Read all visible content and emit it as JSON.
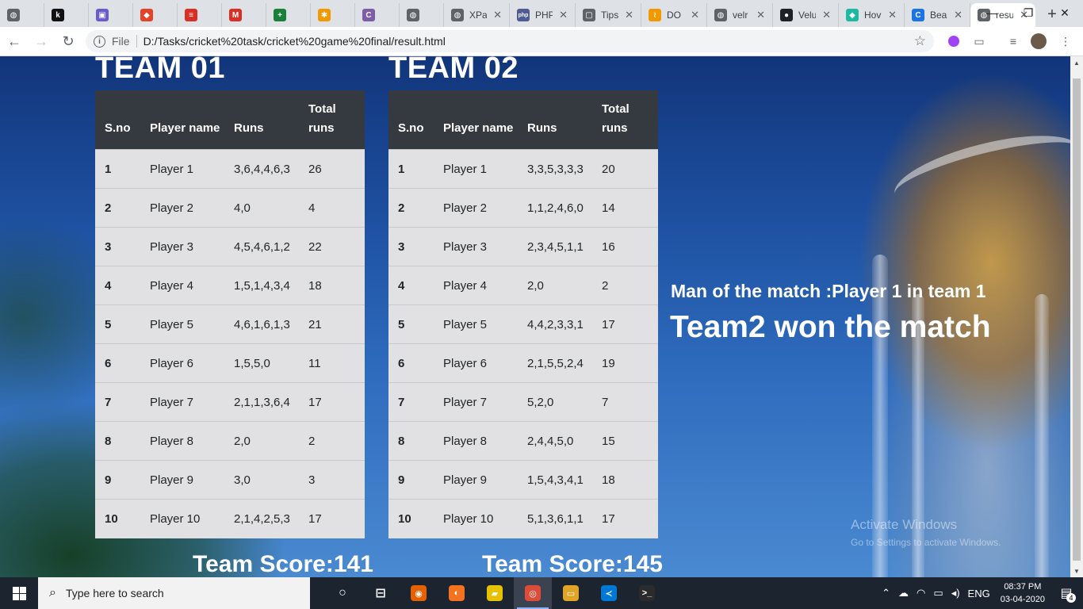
{
  "browser": {
    "tabs": [
      {
        "title": "",
        "icon": "globe-icon",
        "color": "#5f6368",
        "glyph": "◍"
      },
      {
        "title": "",
        "icon": "k-logo-icon",
        "color": "#111111",
        "glyph": "k"
      },
      {
        "title": "",
        "icon": "chat-icon",
        "color": "#6a5acd",
        "glyph": "▣"
      },
      {
        "title": "",
        "icon": "gitlab-icon",
        "color": "#e24329",
        "glyph": "◆"
      },
      {
        "title": "",
        "icon": "notes-icon",
        "color": "#d93025",
        "glyph": "≡"
      },
      {
        "title": "",
        "icon": "gmail-icon",
        "color": "#d93025",
        "glyph": "M"
      },
      {
        "title": "",
        "icon": "plus-doc-icon",
        "color": "#188038",
        "glyph": "+"
      },
      {
        "title": "",
        "icon": "sparkle-icon",
        "color": "#f29900",
        "glyph": "✱"
      },
      {
        "title": "",
        "icon": "c-logo-icon",
        "color": "#7b5ea7",
        "glyph": "C"
      },
      {
        "title": "",
        "icon": "globe-icon",
        "color": "#5f6368",
        "glyph": "◍"
      },
      {
        "title": "XPa",
        "icon": "globe-icon",
        "color": "#5f6368",
        "glyph": "◍"
      },
      {
        "title": "PHP",
        "icon": "php-icon",
        "color": "#4f5b93",
        "glyph": "php"
      },
      {
        "title": "Tips",
        "icon": "shield-icon",
        "color": "#5f6368",
        "glyph": "▢"
      },
      {
        "title": "DO",
        "icon": "brush-icon",
        "color": "#f29900",
        "glyph": "≀"
      },
      {
        "title": "velr",
        "icon": "globe-icon",
        "color": "#5f6368",
        "glyph": "◍"
      },
      {
        "title": "Velu",
        "icon": "github-icon",
        "color": "#202124",
        "glyph": "●"
      },
      {
        "title": "Hov",
        "icon": "gem-icon",
        "color": "#1db9a0",
        "glyph": "◆"
      },
      {
        "title": "Bea",
        "icon": "c-logo-icon",
        "color": "#1a73e8",
        "glyph": "C"
      }
    ],
    "active_tab": {
      "title": "resu",
      "icon": "globe-icon"
    },
    "new_tab": "+",
    "window": {
      "minimize": "—",
      "maximize": "❐",
      "close": "✕"
    },
    "address": {
      "file_label": "File",
      "url": "D:/Tasks/cricket%20task/cricket%20game%20final/result.html"
    }
  },
  "page": {
    "teams": [
      {
        "title": "TEAM 01",
        "headers": [
          "S.no",
          "Player name",
          "Runs",
          "Total runs"
        ],
        "rows": [
          [
            "1",
            "Player 1",
            "3,6,4,4,6,3",
            "26"
          ],
          [
            "2",
            "Player 2",
            "4,0",
            "4"
          ],
          [
            "3",
            "Player 3",
            "4,5,4,6,1,2",
            "22"
          ],
          [
            "4",
            "Player 4",
            "1,5,1,4,3,4",
            "18"
          ],
          [
            "5",
            "Player 5",
            "4,6,1,6,1,3",
            "21"
          ],
          [
            "6",
            "Player 6",
            "1,5,5,0",
            "11"
          ],
          [
            "7",
            "Player 7",
            "2,1,1,3,6,4",
            "17"
          ],
          [
            "8",
            "Player 8",
            "2,0",
            "2"
          ],
          [
            "9",
            "Player 9",
            "3,0",
            "3"
          ],
          [
            "10",
            "Player 10",
            "2,1,4,2,5,3",
            "17"
          ]
        ],
        "team_score": "Team Score:141"
      },
      {
        "title": "TEAM 02",
        "headers": [
          "S.no",
          "Player name",
          "Runs",
          "Total runs"
        ],
        "rows": [
          [
            "1",
            "Player 1",
            "3,3,5,3,3,3",
            "20"
          ],
          [
            "2",
            "Player 2",
            "1,1,2,4,6,0",
            "14"
          ],
          [
            "3",
            "Player 3",
            "2,3,4,5,1,1",
            "16"
          ],
          [
            "4",
            "Player 4",
            "2,0",
            "2"
          ],
          [
            "5",
            "Player 5",
            "4,4,2,3,3,1",
            "17"
          ],
          [
            "6",
            "Player 6",
            "2,1,5,5,2,4",
            "19"
          ],
          [
            "7",
            "Player 7",
            "5,2,0",
            "7"
          ],
          [
            "8",
            "Player 8",
            "2,4,4,5,0",
            "15"
          ],
          [
            "9",
            "Player 9",
            "1,5,4,3,4,1",
            "18"
          ],
          [
            "10",
            "Player 10",
            "5,1,3,6,1,1",
            "17"
          ]
        ],
        "team_score": "Team Score:145"
      }
    ],
    "man_of_the_match": "Man of the match :Player 1 in team 1",
    "result": "Team2 won the match",
    "watermark": {
      "line1": "Activate Windows",
      "line2": "Go to Settings to activate Windows."
    }
  },
  "taskbar": {
    "search_placeholder": "Type here to search",
    "apps": [
      {
        "name": "task-view-icon",
        "glyph": "○",
        "color": "#1c2430"
      },
      {
        "name": "timeline-icon",
        "glyph": "⊟",
        "color": "#1c2430"
      },
      {
        "name": "firefox-icon",
        "glyph": "◉",
        "color": "#e66000"
      },
      {
        "name": "eclipse-icon",
        "glyph": "◐",
        "color": "#f37321"
      },
      {
        "name": "sticky-notes-icon",
        "glyph": "▰",
        "color": "#e6c200"
      },
      {
        "name": "chrome-icon",
        "glyph": "◎",
        "color": "#dd4b39"
      },
      {
        "name": "file-explorer-icon",
        "glyph": "▭",
        "color": "#e0a526"
      },
      {
        "name": "vscode-icon",
        "glyph": "≺",
        "color": "#0078d4"
      },
      {
        "name": "terminal-icon",
        "glyph": ">_",
        "color": "#2b2b2b"
      }
    ],
    "language": "ENG",
    "time": "08:37 PM",
    "date": "03-04-2020",
    "notifications": "4"
  },
  "colors": {
    "table_header": "#343a40",
    "table_row": "#e1e1e3",
    "tab_strip": "#dee1e6",
    "taskbar": "#1c2430"
  }
}
